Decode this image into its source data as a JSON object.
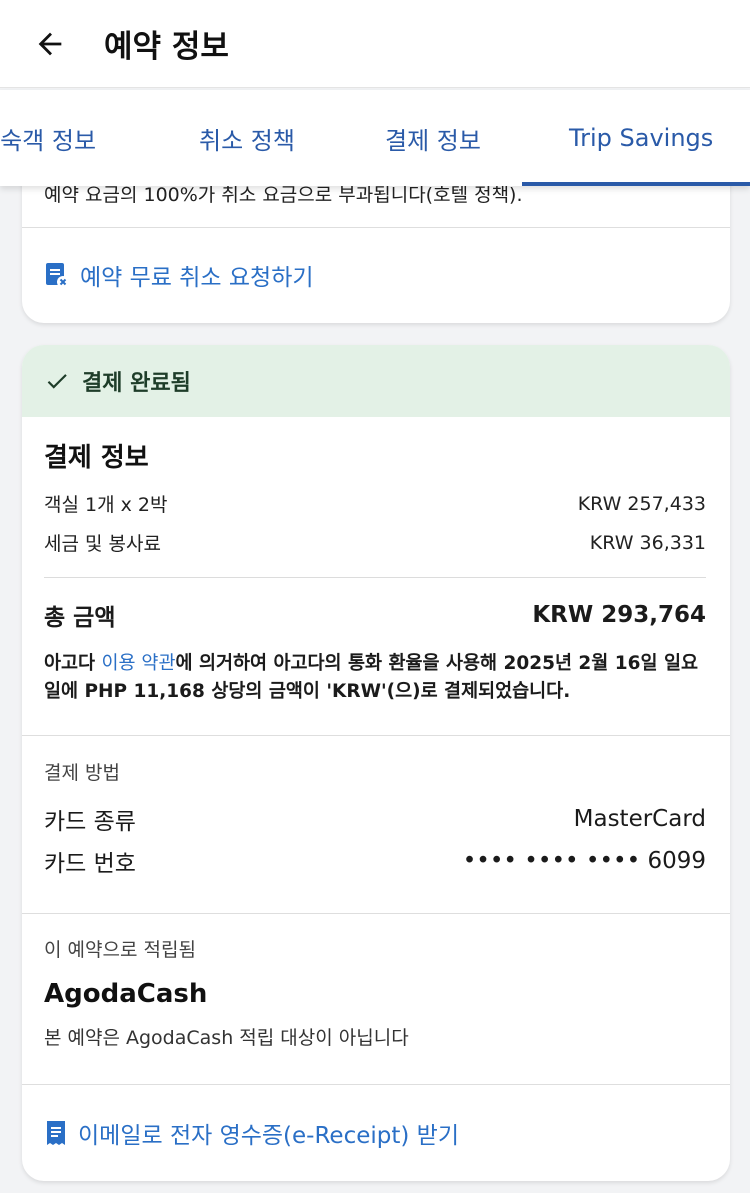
{
  "header": {
    "title": "예약 정보"
  },
  "tabs": [
    {
      "label": "투숙객 정보"
    },
    {
      "label": "취소 정책"
    },
    {
      "label": "결제 정보"
    },
    {
      "label": "Trip Savings"
    }
  ],
  "cancellation": {
    "cut_text": "예약 요금의 100%가 취소 요금으로 부과됩니다(호텔 정책).",
    "free_cancel_label": "예약 무료 취소 요청하기"
  },
  "payment": {
    "status": "결제 완료됨",
    "title": "결제 정보",
    "rows": [
      {
        "label": "객실 1개 x 2박",
        "value": "KRW 257,433"
      },
      {
        "label": "세금 및 봉사료",
        "value": "KRW 36,331"
      }
    ],
    "total_label": "총 금액",
    "total_value": "KRW 293,764",
    "notice_pre": "아고다 ",
    "notice_link": "이용 약관",
    "notice_post": "에 의거하여 아고다의 통화 환율을 사용해 2025년 2월 16일 일요일에 PHP 11,168 상당의 금액이 'KRW'(으)로 결제되었습니다."
  },
  "method": {
    "caption": "결제 방법",
    "card_type_label": "카드 종류",
    "card_type_value": "MasterCard",
    "card_number_label": "카드 번호",
    "card_number_value": "•••• •••• •••• 6099"
  },
  "rewards": {
    "caption": "이 예약으로 적립됨",
    "title": "AgodaCash",
    "sub": "본 예약은 AgodaCash 적립 대상이 아닙니다"
  },
  "receipt": {
    "label": "이메일로 전자 영수증(e-Receipt) 받기"
  },
  "colors": {
    "accent": "#2a6fc6",
    "tab": "#2a5aa8",
    "success_bg": "#e3f1e6"
  }
}
